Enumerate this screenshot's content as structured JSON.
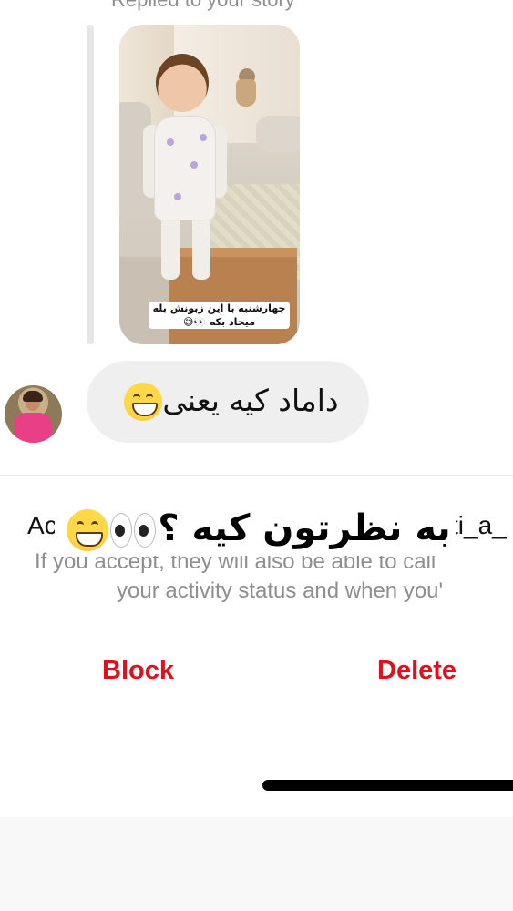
{
  "reply_header": "Replied to your story",
  "story": {
    "caption_line1": "چهارشنبه با این زبونش بله",
    "caption_line2": "میخاد بکه"
  },
  "message": {
    "text": "داماد کیه یعنی",
    "emoji": "grinning-face-icon"
  },
  "request_panel": {
    "title_fragment": "Ac",
    "username_fragment": "ti_a_",
    "info_line1": "If you accept, they will also be able to call",
    "info_line2": "your activity status and when you'"
  },
  "overlay": {
    "text": "به نظرتون کیه ؟"
  },
  "actions": {
    "block_label": "Block",
    "delete_label": "Delete"
  },
  "colors": {
    "action_red": "#e0101e",
    "bubble_gray": "#efefef",
    "secondary_text": "#8e8e8e"
  }
}
